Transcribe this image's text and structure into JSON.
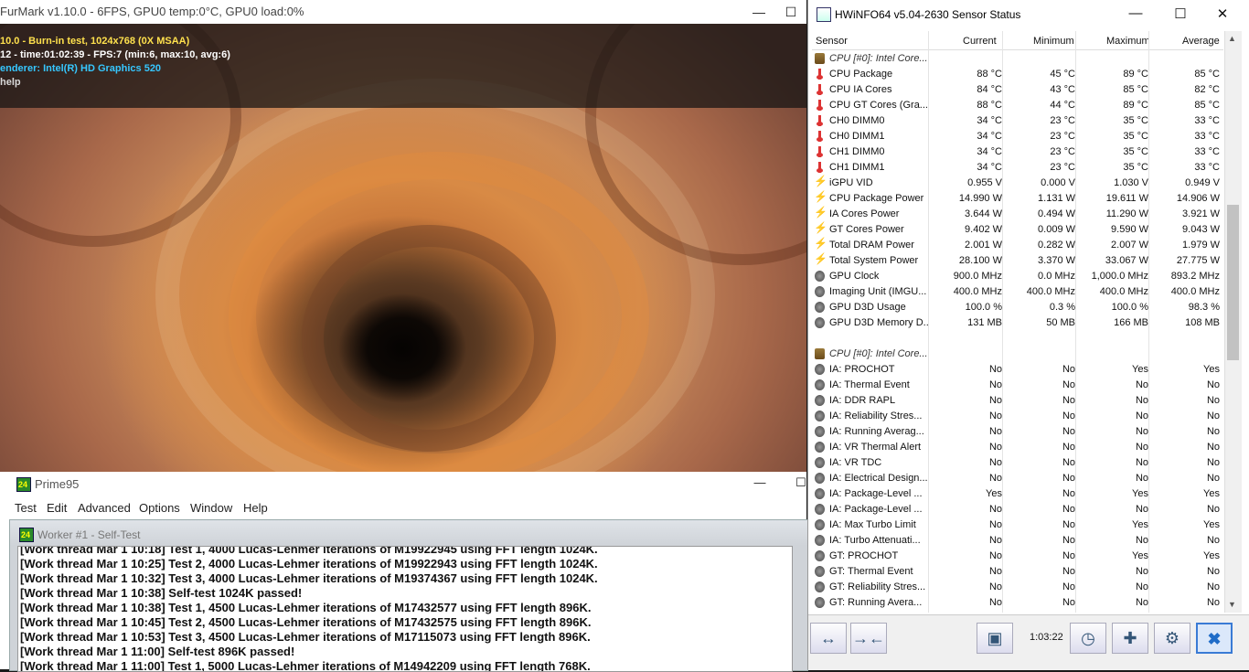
{
  "furmark": {
    "title": "FurMark v1.10.0 - 6FPS, GPU0 temp:0°C, GPU0 load:0%",
    "overlay": [
      {
        "text": "10.0 - Burn-in test, 1024x768 (0X MSAA)",
        "color": "#ffe14d"
      },
      {
        "text": "12 - time:01:02:39 - FPS:7 (min:6, max:10, avg:6)",
        "color": "#ffffff"
      },
      {
        "text": "enderer: Intel(R) HD Graphics 520",
        "color": "#36c7ff"
      },
      {
        "text": "help",
        "color": "#d8d8d8"
      }
    ]
  },
  "prime95": {
    "title": "Prime95",
    "menu": [
      "Test",
      "Edit",
      "Advanced",
      "Options",
      "Window",
      "Help"
    ],
    "worker_title": "Worker #1 - Self-Test",
    "log": [
      "[Work thread Mar 1 10:18] Test 1, 4000 Lucas-Lehmer iterations of M19922945 using FFT length 1024K.",
      "[Work thread Mar 1 10:25] Test 2, 4000 Lucas-Lehmer iterations of M19922943 using FFT length 1024K.",
      "[Work thread Mar 1 10:32] Test 3, 4000 Lucas-Lehmer iterations of M19374367 using FFT length 1024K.",
      "[Work thread Mar 1 10:38] Self-test 1024K passed!",
      "[Work thread Mar 1 10:38] Test 1, 4500 Lucas-Lehmer iterations of M17432577 using FFT length 896K.",
      "[Work thread Mar 1 10:45] Test 2, 4500 Lucas-Lehmer iterations of M17432575 using FFT length 896K.",
      "[Work thread Mar 1 10:53] Test 3, 4500 Lucas-Lehmer iterations of M17115073 using FFT length 896K.",
      "[Work thread Mar 1 11:00] Self-test 896K passed!",
      "[Work thread Mar 1 11:00] Test 1, 5000 Lucas-Lehmer iterations of M14942209 using FFT length 768K."
    ]
  },
  "hwinfo": {
    "title": "HWiNFO64 v5.04-2630 Sensor Status",
    "columns": [
      "Sensor",
      "Current",
      "Minimum",
      "Maximum",
      "Average"
    ],
    "rows": [
      {
        "g": true,
        "icon": "chip",
        "name": "CPU [#0]: Intel Core..."
      },
      {
        "icon": "thermo",
        "name": "CPU Package",
        "c": "88 °C",
        "mn": "45 °C",
        "mx": "89 °C",
        "av": "85 °C"
      },
      {
        "icon": "thermo",
        "name": "CPU IA Cores",
        "c": "84 °C",
        "mn": "43 °C",
        "mx": "85 °C",
        "av": "82 °C"
      },
      {
        "icon": "thermo",
        "name": "CPU GT Cores (Gra...",
        "c": "88 °C",
        "mn": "44 °C",
        "mx": "89 °C",
        "av": "85 °C"
      },
      {
        "icon": "thermo",
        "name": "CH0 DIMM0",
        "c": "34 °C",
        "mn": "23 °C",
        "mx": "35 °C",
        "av": "33 °C"
      },
      {
        "icon": "thermo",
        "name": "CH0 DIMM1",
        "c": "34 °C",
        "mn": "23 °C",
        "mx": "35 °C",
        "av": "33 °C"
      },
      {
        "icon": "thermo",
        "name": "CH1 DIMM0",
        "c": "34 °C",
        "mn": "23 °C",
        "mx": "35 °C",
        "av": "33 °C"
      },
      {
        "icon": "thermo",
        "name": "CH1 DIMM1",
        "c": "34 °C",
        "mn": "23 °C",
        "mx": "35 °C",
        "av": "33 °C"
      },
      {
        "icon": "bolt",
        "name": "iGPU VID",
        "c": "0.955 V",
        "mn": "0.000 V",
        "mx": "1.030 V",
        "av": "0.949 V"
      },
      {
        "icon": "bolt",
        "name": "CPU Package Power",
        "c": "14.990 W",
        "mn": "1.131 W",
        "mx": "19.611 W",
        "av": "14.906 W"
      },
      {
        "icon": "bolt",
        "name": "IA Cores Power",
        "c": "3.644 W",
        "mn": "0.494 W",
        "mx": "11.290 W",
        "av": "3.921 W"
      },
      {
        "icon": "bolt",
        "name": "GT Cores Power",
        "c": "9.402 W",
        "mn": "0.009 W",
        "mx": "9.590 W",
        "av": "9.043 W"
      },
      {
        "icon": "bolt",
        "name": "Total DRAM Power",
        "c": "2.001 W",
        "mn": "0.282 W",
        "mx": "2.007 W",
        "av": "1.979 W"
      },
      {
        "icon": "bolt",
        "name": "Total System Power",
        "c": "28.100 W",
        "mn": "3.370 W",
        "mx": "33.067 W",
        "av": "27.775 W"
      },
      {
        "icon": "gauge",
        "name": "GPU Clock",
        "c": "900.0 MHz",
        "mn": "0.0 MHz",
        "mx": "1,000.0 MHz",
        "av": "893.2 MHz"
      },
      {
        "icon": "gauge",
        "name": "Imaging Unit (IMGU...",
        "c": "400.0 MHz",
        "mn": "400.0 MHz",
        "mx": "400.0 MHz",
        "av": "400.0 MHz"
      },
      {
        "icon": "gauge",
        "name": "GPU D3D Usage",
        "c": "100.0 %",
        "mn": "0.3 %",
        "mx": "100.0 %",
        "av": "98.3 %"
      },
      {
        "icon": "gauge",
        "name": "GPU D3D Memory D...",
        "c": "131 MB",
        "mn": "50 MB",
        "mx": "166 MB",
        "av": "108 MB"
      },
      {
        "blank": true
      },
      {
        "g": true,
        "icon": "chip",
        "name": "CPU [#0]: Intel Core..."
      },
      {
        "icon": "gauge",
        "name": "IA: PROCHOT",
        "c": "No",
        "mn": "No",
        "mx": "Yes",
        "av": "Yes"
      },
      {
        "icon": "gauge",
        "name": "IA: Thermal Event",
        "c": "No",
        "mn": "No",
        "mx": "No",
        "av": "No"
      },
      {
        "icon": "gauge",
        "name": "IA: DDR RAPL",
        "c": "No",
        "mn": "No",
        "mx": "No",
        "av": "No"
      },
      {
        "icon": "gauge",
        "name": "IA: Reliability Stres...",
        "c": "No",
        "mn": "No",
        "mx": "No",
        "av": "No"
      },
      {
        "icon": "gauge",
        "name": "IA: Running Averag...",
        "c": "No",
        "mn": "No",
        "mx": "No",
        "av": "No"
      },
      {
        "icon": "gauge",
        "name": "IA: VR Thermal Alert",
        "c": "No",
        "mn": "No",
        "mx": "No",
        "av": "No"
      },
      {
        "icon": "gauge",
        "name": "IA: VR TDC",
        "c": "No",
        "mn": "No",
        "mx": "No",
        "av": "No"
      },
      {
        "icon": "gauge",
        "name": "IA: Electrical Design...",
        "c": "No",
        "mn": "No",
        "mx": "No",
        "av": "No"
      },
      {
        "icon": "gauge",
        "name": "IA: Package-Level ...",
        "c": "Yes",
        "mn": "No",
        "mx": "Yes",
        "av": "Yes"
      },
      {
        "icon": "gauge",
        "name": "IA: Package-Level ...",
        "c": "No",
        "mn": "No",
        "mx": "No",
        "av": "No"
      },
      {
        "icon": "gauge",
        "name": "IA: Max Turbo Limit",
        "c": "No",
        "mn": "No",
        "mx": "Yes",
        "av": "Yes"
      },
      {
        "icon": "gauge",
        "name": "IA: Turbo Attenuati...",
        "c": "No",
        "mn": "No",
        "mx": "No",
        "av": "No"
      },
      {
        "icon": "gauge",
        "name": "GT: PROCHOT",
        "c": "No",
        "mn": "No",
        "mx": "Yes",
        "av": "Yes"
      },
      {
        "icon": "gauge",
        "name": "GT: Thermal Event",
        "c": "No",
        "mn": "No",
        "mx": "No",
        "av": "No"
      },
      {
        "icon": "gauge",
        "name": "GT: Reliability Stres...",
        "c": "No",
        "mn": "No",
        "mx": "No",
        "av": "No"
      },
      {
        "icon": "gauge",
        "name": "GT: Running Avera...",
        "c": "No",
        "mn": "No",
        "mx": "No",
        "av": "No"
      }
    ],
    "elapsed": "1:03:22"
  }
}
